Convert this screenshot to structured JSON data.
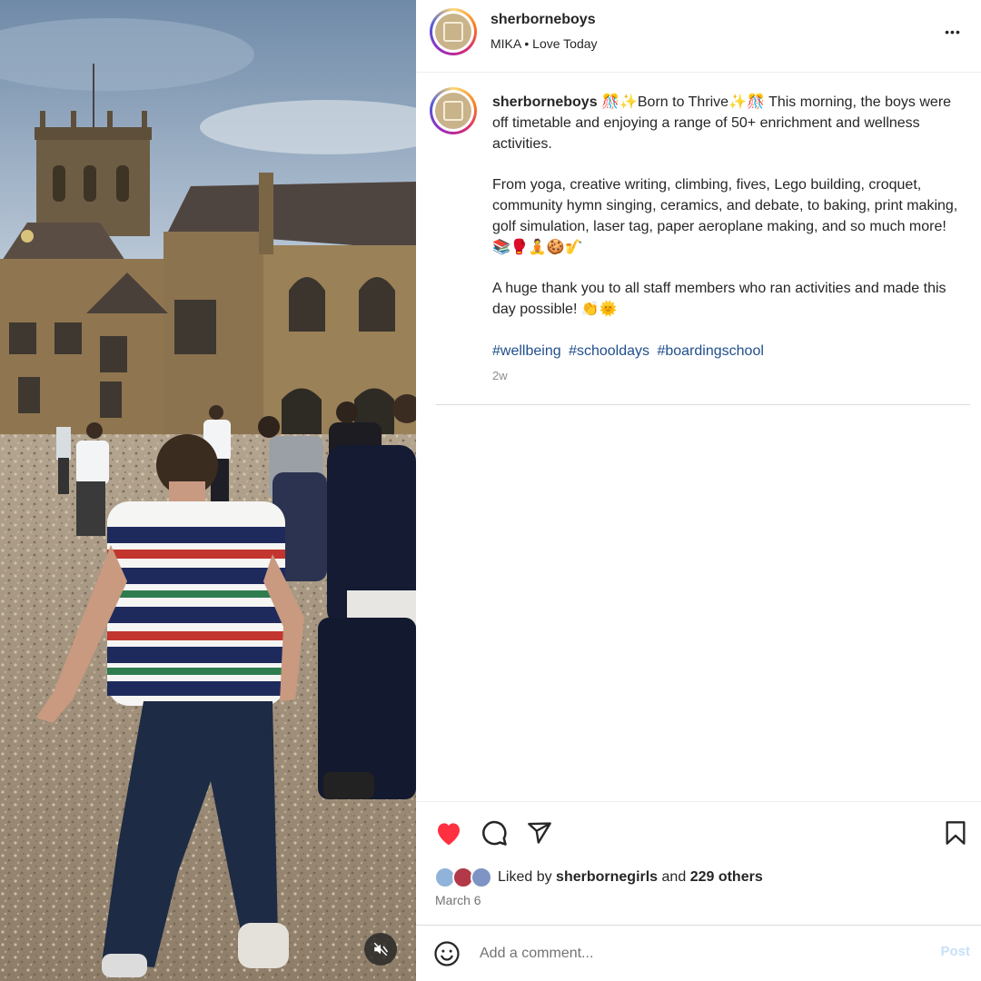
{
  "post": {
    "author": "sherborneboys",
    "audio": "MIKA",
    "audio_separator": "•",
    "audio_track": "Love Today",
    "more_label": "•••"
  },
  "caption": {
    "author": "sherborneboys",
    "paragraph1": " 🎊✨Born to Thrive✨🎊 This morning, the boys were off timetable and enjoying a range of 50+ enrichment and wellness activities.",
    "paragraph2": "From yoga, creative writing, climbing, fives, Lego building, croquet, community hymn singing, ceramics, and debate, to baking, print making, golf simulation, laser tag, paper aeroplane making, and so much more! 📚🥊🧘🍪🎷",
    "paragraph3": "A huge thank you to all staff members who ran activities and made this day possible! 👏🌞",
    "hashtags": [
      "#wellbeing",
      "#schooldays",
      "#boardingschool"
    ],
    "time": "2w"
  },
  "engagement": {
    "liked_prefix": "Liked by",
    "liked_user": "sherbornegirls",
    "liked_and": "and",
    "liked_others": "229 others",
    "date": "March 6"
  },
  "comment": {
    "placeholder": "Add a comment...",
    "post_label": "Post"
  },
  "icons": {
    "like": "heart-filled-icon",
    "comment": "comment-icon",
    "share": "send-icon",
    "save": "bookmark-icon",
    "emoji": "emoji-icon",
    "mute": "speaker-muted-icon"
  },
  "colors": {
    "like_red": "#ff3040",
    "hashtag_blue": "#1f4e8c",
    "post_disabled": "#c7e0f8",
    "muted_text": "#737373"
  }
}
